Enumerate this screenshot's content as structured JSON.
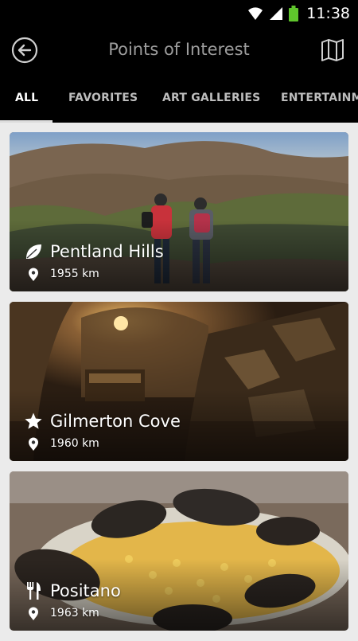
{
  "status_bar": {
    "time": "11:38",
    "icons": [
      "wifi-icon",
      "signal-icon",
      "battery-icon"
    ],
    "battery_color": "#5fc52c"
  },
  "header": {
    "title": "Points of Interest",
    "back_icon": "back-arrow-icon",
    "map_icon": "map-icon"
  },
  "tabs": [
    {
      "label": "ALL",
      "active": true
    },
    {
      "label": "FAVORITES",
      "active": false
    },
    {
      "label": "ART GALLERIES",
      "active": false
    },
    {
      "label": "ENTERTAINME",
      "active": false
    }
  ],
  "places": [
    {
      "name": "Pentland Hills",
      "distance": "1955 km",
      "category_icon": "leaf-icon",
      "image": "hikers-on-hills"
    },
    {
      "name": "Gilmerton Cove",
      "distance": "1960 km",
      "category_icon": "star-icon",
      "image": "stone-cave"
    },
    {
      "name": "Positano",
      "distance": "1963 km",
      "category_icon": "fork-knife-icon",
      "image": "mussels-paella"
    }
  ],
  "colors": {
    "app_bar": "#000000",
    "background": "#ebebeb",
    "title": "#9d9d9d",
    "tab_active": "#ffffff",
    "tab_inactive": "#bdbdbd"
  }
}
